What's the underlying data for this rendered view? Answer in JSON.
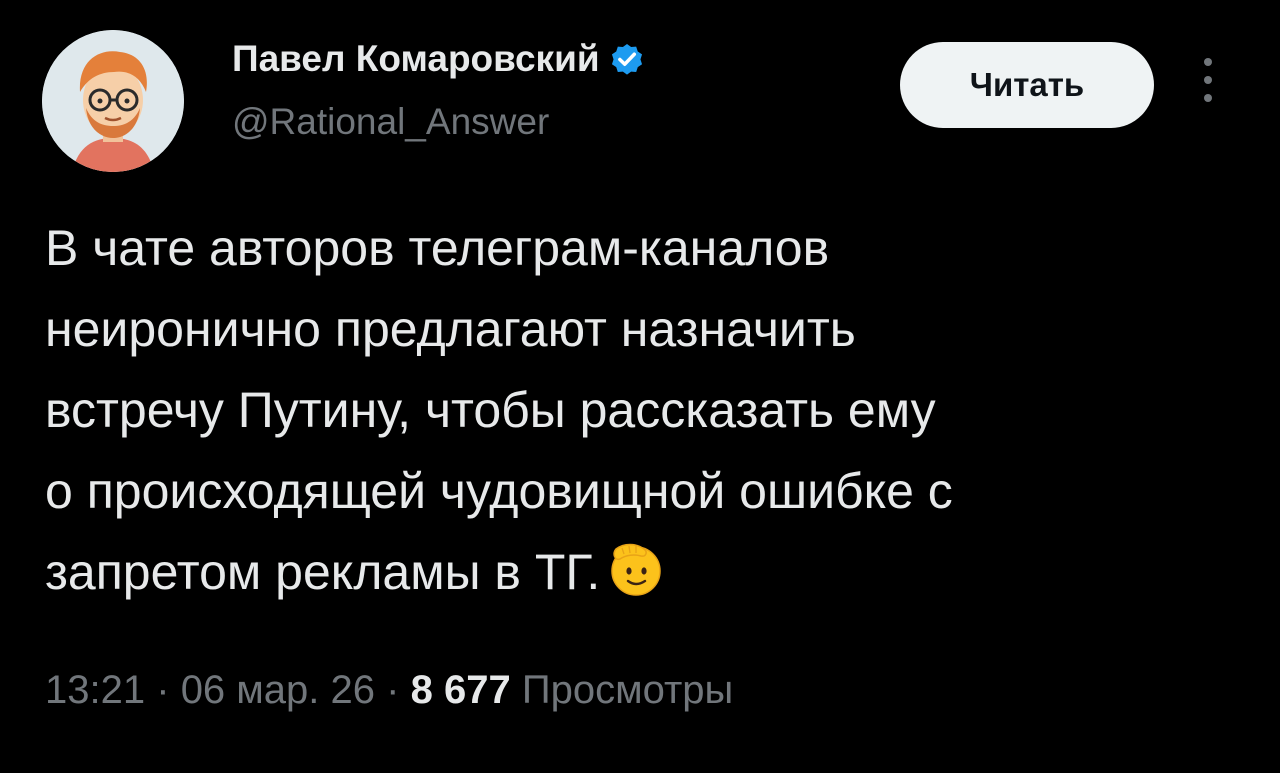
{
  "author": {
    "name": "Павел Комаровский",
    "handle": "@Rational_Answer",
    "verified_icon": "verified-badge-icon",
    "verified_color": "#1d9bf0"
  },
  "actions": {
    "follow_label": "Читать",
    "more_icon": "more-vertical-icon"
  },
  "tweet": {
    "lines": [
      "В чате авторов телеграм-каналов",
      "неиронично предлагают назначить",
      "встречу Путину, чтобы рассказать ему",
      "о происходящей чудовищной ошибке с",
      "запретом рекламы в ТГ."
    ],
    "emoji": "saluting-face-emoji"
  },
  "meta": {
    "time": "13:21",
    "separator": "·",
    "date": "06 мар. 26",
    "views_count": "8 677",
    "views_label": "Просмотры"
  },
  "colors": {
    "background": "#000000",
    "text": "#e7e9ea",
    "secondary_text": "#71767b",
    "button_bg": "#eff3f4",
    "button_text": "#0f1419"
  }
}
